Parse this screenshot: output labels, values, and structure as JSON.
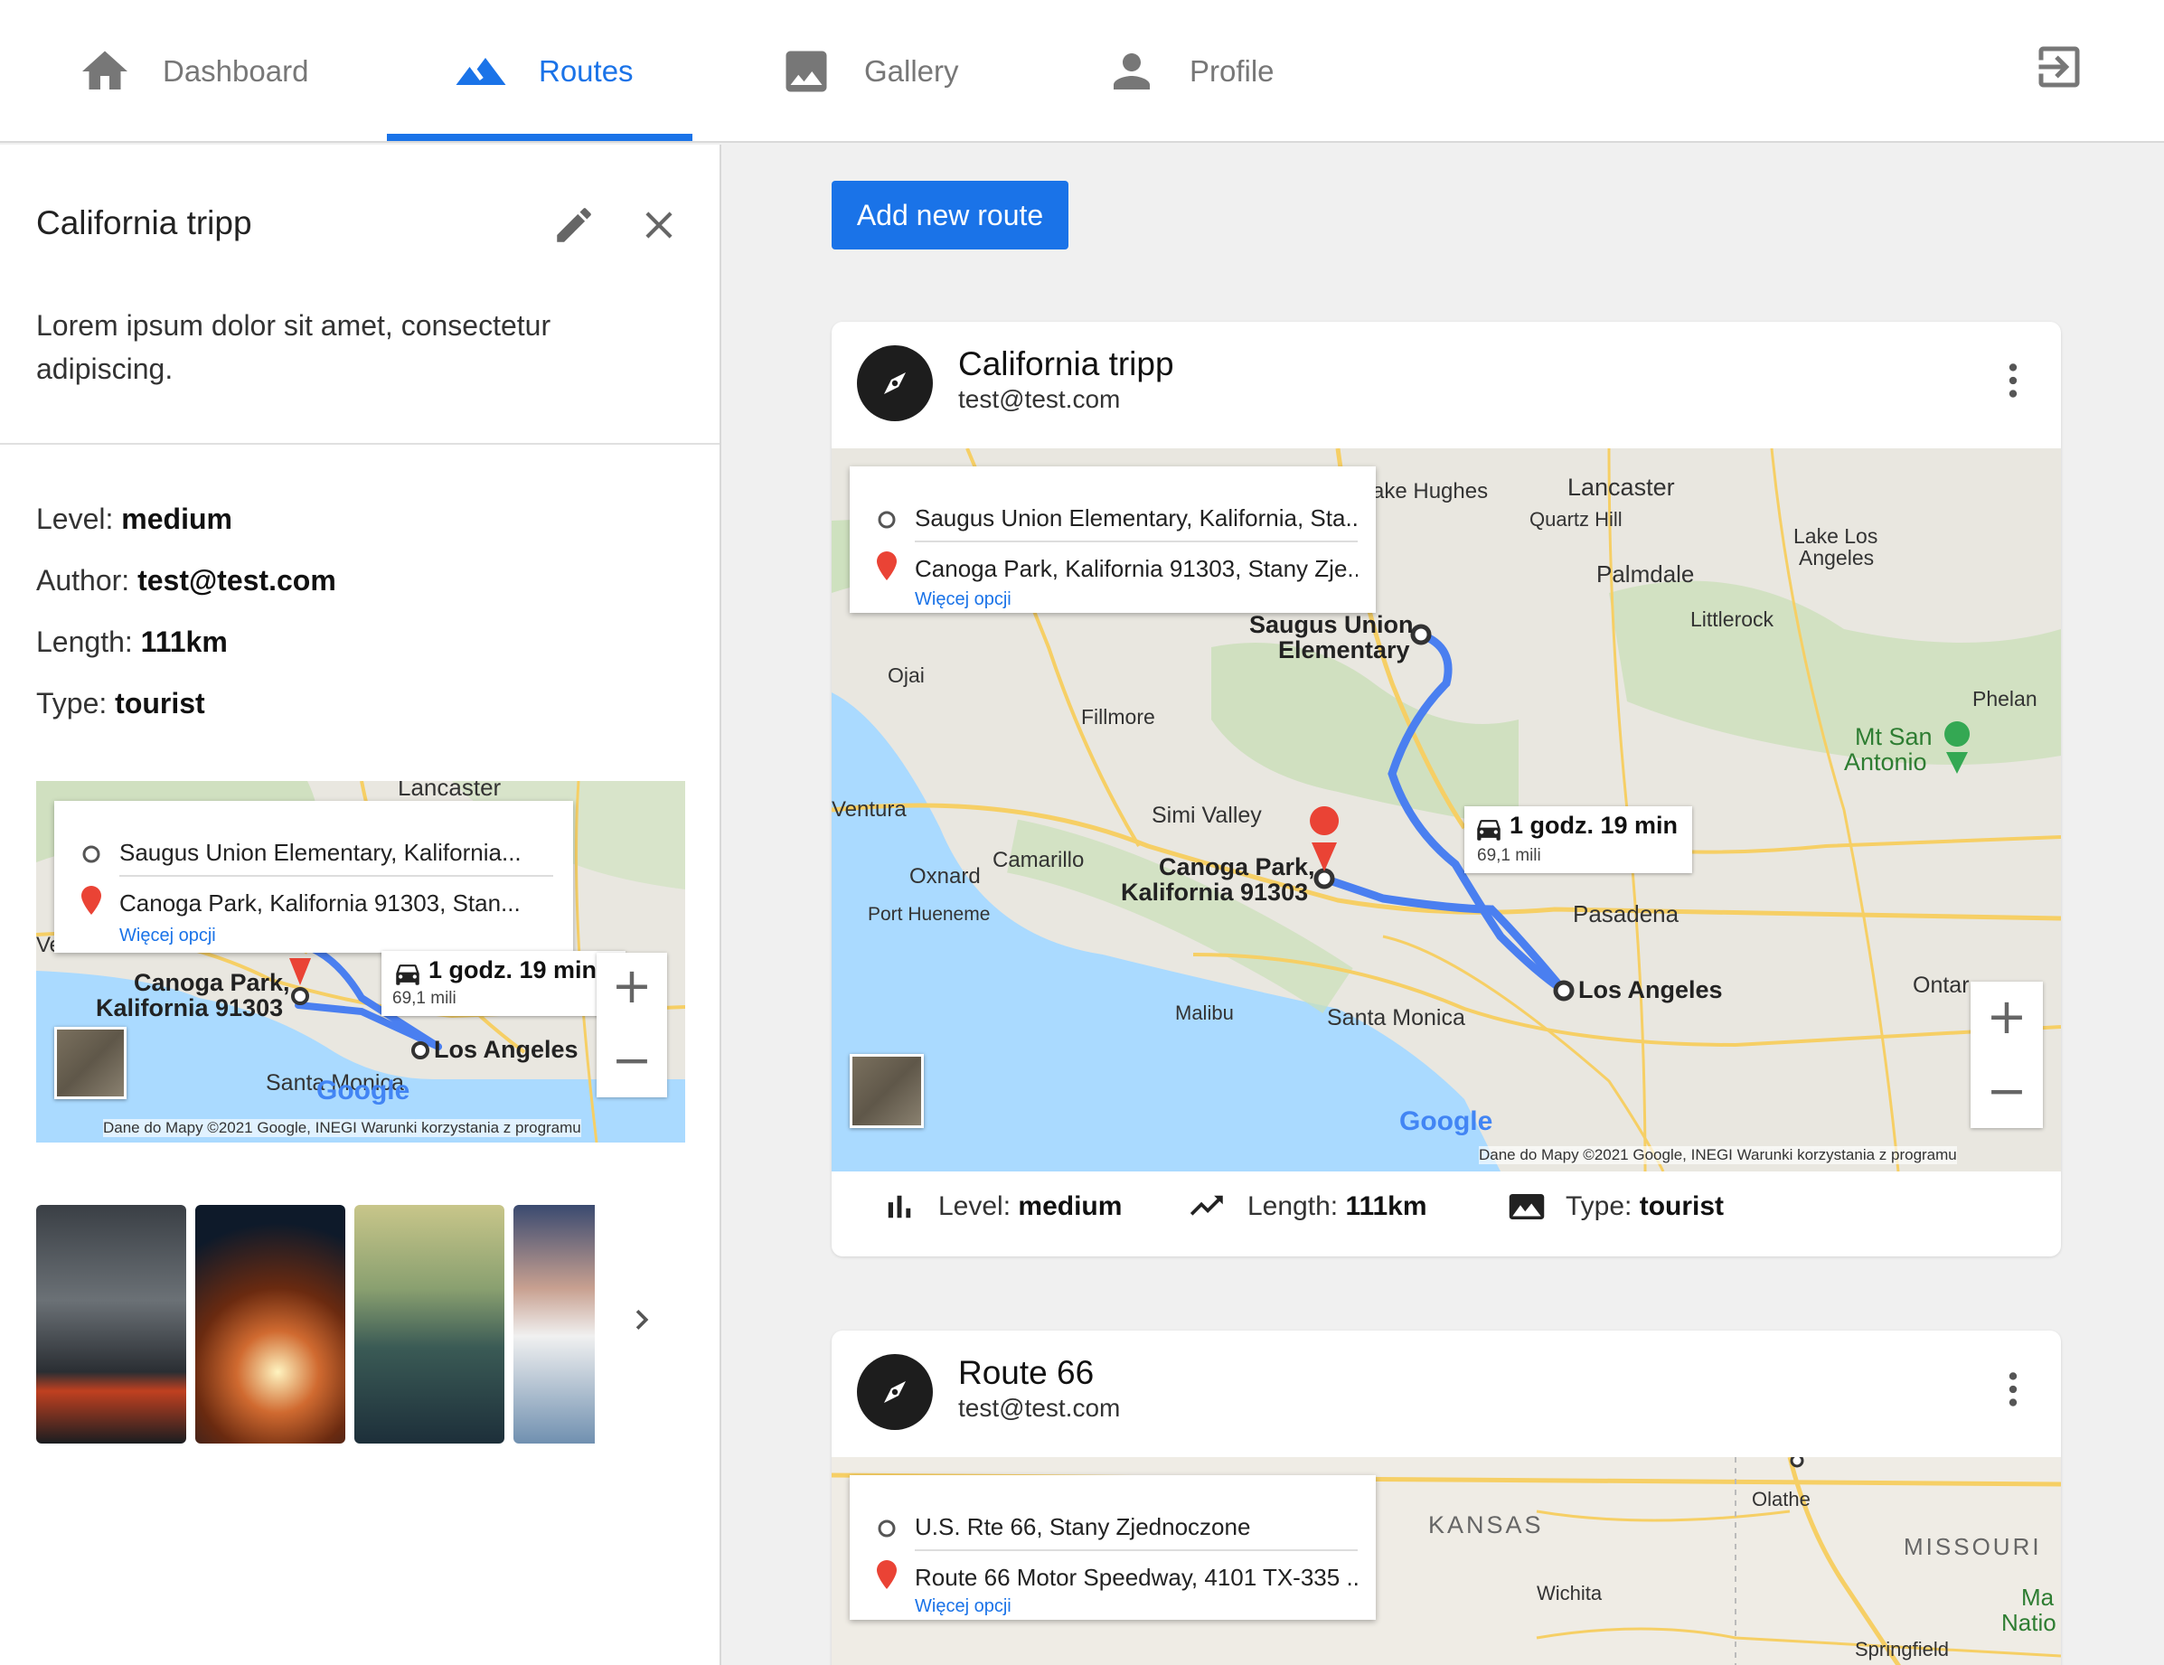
{
  "nav": {
    "tabs": [
      {
        "label": "Dashboard",
        "icon": "home-icon"
      },
      {
        "label": "Routes",
        "icon": "mountain-icon",
        "active": true
      },
      {
        "label": "Gallery",
        "icon": "image-icon"
      },
      {
        "label": "Profile",
        "icon": "person-icon"
      }
    ],
    "logout_icon": "logout-icon",
    "accent_color": "#1a73e8"
  },
  "detail": {
    "title": "California tripp",
    "description": "Lorem ipsum dolor sit amet, consectetur adipiscing.",
    "level_label": "Level:",
    "level": "medium",
    "author_label": "Author:",
    "author": "test@test.com",
    "length_label": "Length:",
    "length": "111km",
    "type_label": "Type:",
    "type": "tourist",
    "map": {
      "origin": "Saugus Union Elementary, Kalifornia...",
      "destination": "Canoga Park, Kalifornia 91303, Stan...",
      "more": "Więcej opcji",
      "time": "1 godz. 19 min",
      "distance": "69,1 mili",
      "place_top": "Lancaster",
      "place_a": "Canoga Park,",
      "place_b": "Kalifornia 91303",
      "place_c": "Los Angeles",
      "place_d": "Santa Monica",
      "place_e": "Ventura",
      "google": "Google",
      "attribution": "Dane do Mapy ©2021 Google, INEGI    Warunki korzystania z programu",
      "zoom_in": "+",
      "zoom_out": "−"
    }
  },
  "main": {
    "add_button": "Add new route",
    "cards": [
      {
        "title": "California tripp",
        "author": "test@test.com",
        "map": {
          "origin": "Saugus Union Elementary, Kalifornia, Sta...",
          "destination": "Canoga Park, Kalifornia 91303, Stany Zje...",
          "more": "Więcej opcji",
          "time": "1 godz. 19 min",
          "distance": "69,1 mili",
          "places": {
            "lancaster": "Lancaster",
            "lake_hughes": "ake Hughes",
            "quartz_hill": "Quartz Hill",
            "lake_los_angeles_1": "Lake Los",
            "lake_los_angeles_2": "Angeles",
            "palmdale": "Palmdale",
            "littlerock": "Littlerock",
            "saugus_1": "Saugus Union",
            "saugus_2": "Elementary",
            "ojai": "Ojai",
            "phelan": "Phelan",
            "fillmore": "Fillmore",
            "mt_san_antonio_1": "Mt San",
            "mt_san_antonio_2": "Antonio",
            "ventura": "Ventura",
            "simi_valley": "Simi Valley",
            "oxnard": "Oxnard",
            "camarillo": "Camarillo",
            "canoga_1": "Canoga Park,",
            "canoga_2": "Kalifornia 91303",
            "port_hueneme": "Port Hueneme",
            "pasadena": "Pasadena",
            "los_angeles": "Los Angeles",
            "ontario": "Ontar",
            "malibu": "Malibu",
            "santa_monica": "Santa Monica"
          },
          "google": "Google",
          "attribution": "Dane do Mapy ©2021 Google, INEGI    Warunki korzystania z programu",
          "zoom_in": "+",
          "zoom_out": "−"
        },
        "level_label": "Level:",
        "level": "medium",
        "length_label": "Length:",
        "length": "111km",
        "type_label": "Type:",
        "type": "tourist"
      },
      {
        "title": "Route 66",
        "author": "test@test.com",
        "map": {
          "origin": "U.S. Rte 66, Stany Zjednoczone",
          "destination": "Route 66 Motor Speedway, 4101 TX-335 ...",
          "more": "Więcej opcji",
          "places": {
            "kansas": "KANSAS",
            "olathe": "Olathe",
            "missouri": "MISSOURI",
            "wichita": "Wichita",
            "springfield": "Springfield",
            "ma": "Ma",
            "natio": "Natio"
          }
        }
      }
    ]
  }
}
